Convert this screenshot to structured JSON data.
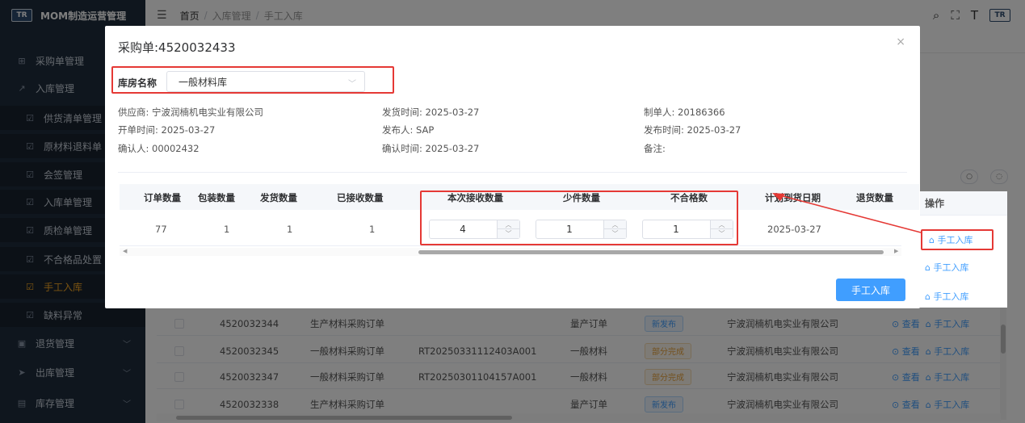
{
  "header": {
    "app_title": "MOM制造运营管理",
    "logo_text": "TR",
    "breadcrumb": [
      "首页",
      "入库管理",
      "手工入库"
    ],
    "tools": [
      "search-icon",
      "fullscreen-icon",
      "font-size-icon",
      "brand-logo"
    ]
  },
  "sidebar": {
    "items": [
      {
        "label": "采购单管理",
        "icon": "cart-icon",
        "level": "top"
      },
      {
        "label": "入库管理",
        "icon": "inbound-icon",
        "level": "top"
      },
      {
        "label": "供货清单管理",
        "icon": "check-icon",
        "level": "sub"
      },
      {
        "label": "原材料退料单",
        "icon": "check-icon",
        "level": "sub"
      },
      {
        "label": "会签管理",
        "icon": "check-icon",
        "level": "sub"
      },
      {
        "label": "入库单管理",
        "icon": "check-icon",
        "level": "sub"
      },
      {
        "label": "质检单管理",
        "icon": "check-icon",
        "level": "sub"
      },
      {
        "label": "不合格品处置",
        "icon": "check-icon",
        "level": "sub"
      },
      {
        "label": "手工入库",
        "icon": "check-icon",
        "level": "sub",
        "active": true
      },
      {
        "label": "缺料异常",
        "icon": "check-icon",
        "level": "sub"
      },
      {
        "label": "退货管理",
        "icon": "return-icon",
        "level": "top"
      },
      {
        "label": "出库管理",
        "icon": "send-icon",
        "level": "top"
      },
      {
        "label": "库存管理",
        "icon": "stock-icon",
        "level": "top"
      }
    ]
  },
  "background_table": {
    "op_header": "操作",
    "op_label": "手工入库",
    "view_label": "查看",
    "rows": [
      {
        "order_no": "4520032344",
        "type": "生产材料采购订单",
        "ref": "",
        "category": "量产订单",
        "status": "新发布",
        "status_color": "blue",
        "supplier": "宁波润楠机电实业有限公司"
      },
      {
        "order_no": "4520032345",
        "type": "一般材料采购订单",
        "ref": "RT20250331112403A001",
        "category": "一般材料",
        "status": "部分完成",
        "status_color": "orange",
        "supplier": "宁波润楠机电实业有限公司"
      },
      {
        "order_no": "4520032347",
        "type": "一般材料采购订单",
        "ref": "RT20250301104157A001",
        "category": "一般材料",
        "status": "部分完成",
        "status_color": "orange",
        "supplier": "宁波润楠机电实业有限公司"
      },
      {
        "order_no": "4520032338",
        "type": "生产材料采购订单",
        "ref": "",
        "category": "量产订单",
        "status": "新发布",
        "status_color": "blue",
        "supplier": "宁波润楠机电实业有限公司"
      }
    ]
  },
  "modal": {
    "title": "采购单:4520032433",
    "close": "×",
    "warehouse_label": "库房名称",
    "warehouse_value": "一般材料库",
    "info": {
      "supplier": "供应商: 宁波润楠机电实业有限公司",
      "ship_time": "发货时间: 2025-03-27",
      "creator": "制单人: 20186366",
      "open_time": "开单时间: 2025-03-27",
      "publisher": "发布人: SAP",
      "publish_time": "发布时间: 2025-03-27",
      "confirmer": "确认人: 00002432",
      "confirm_time": "确认时间: 2025-03-27",
      "remark": "备注:"
    },
    "table": {
      "headers": [
        "订单数量",
        "包装数量",
        "发货数量",
        "已接收数量",
        "本次接收数量",
        "少件数量",
        "不合格数",
        "计划到货日期",
        "退货数量"
      ],
      "row": {
        "order_qty": "77",
        "pack_qty": "1",
        "ship_qty": "1",
        "received_qty": "1",
        "receive_now": "4",
        "short_qty": "1",
        "defect_qty": "1",
        "plan_date": "2025-03-27",
        "return_qty": ""
      }
    },
    "submit_label": "手工入库"
  },
  "colors": {
    "sidebar_bg": "#1f2d3d",
    "active": "#f5a623",
    "primary": "#409eff",
    "highlight": "#e53935"
  }
}
